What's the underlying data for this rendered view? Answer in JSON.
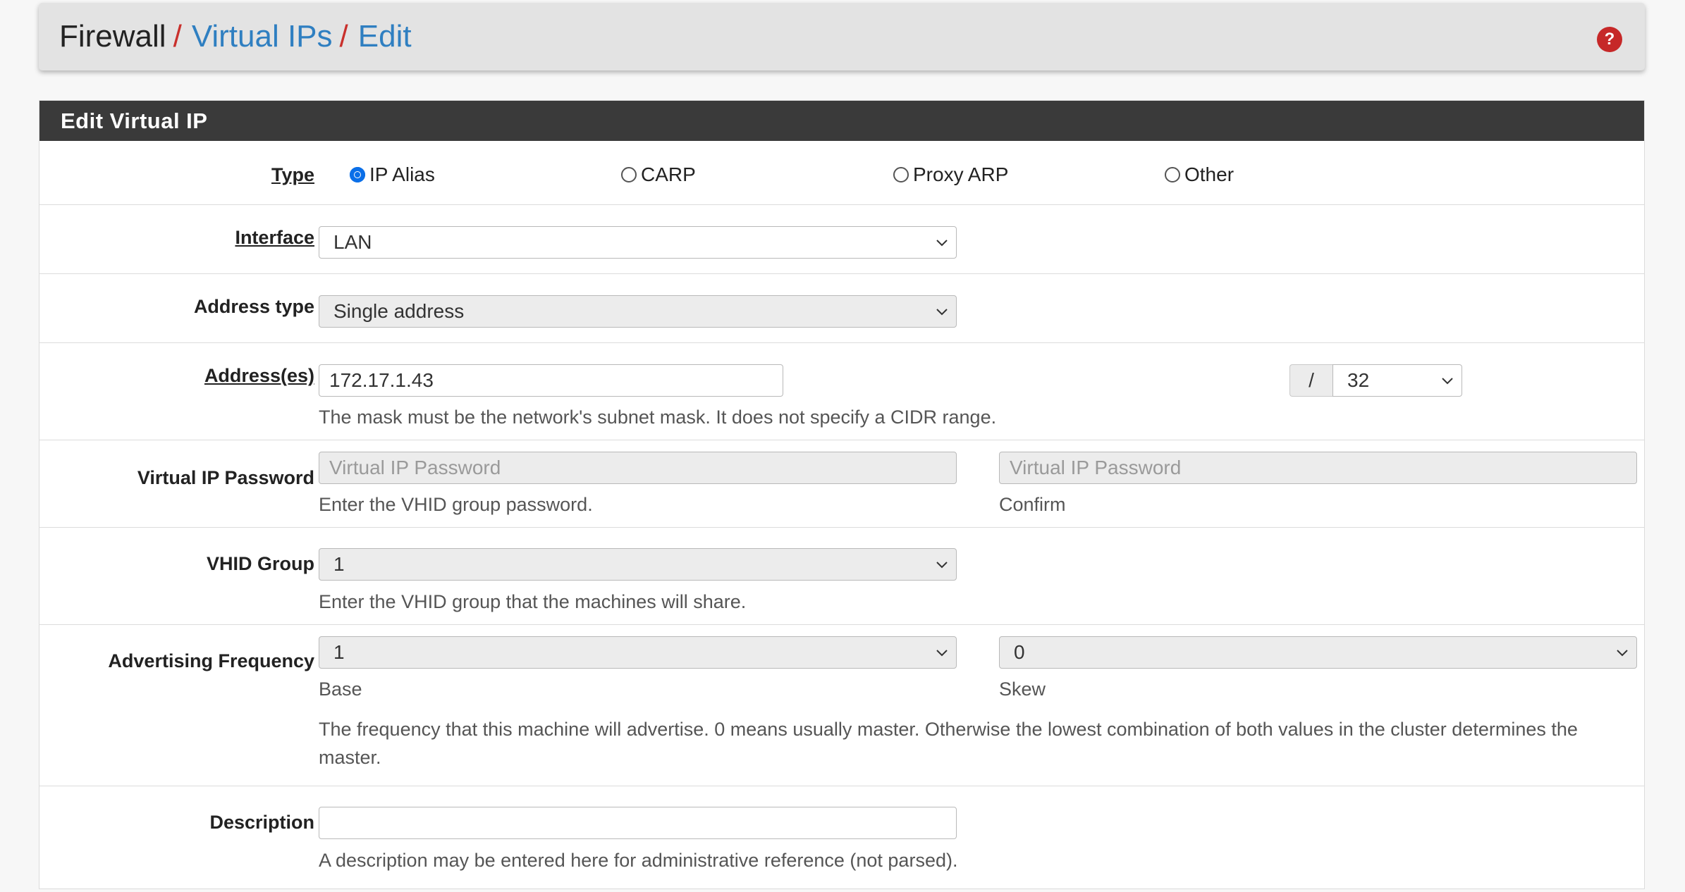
{
  "breadcrumb": {
    "root": "Firewall",
    "separator": "/",
    "items": [
      "Virtual IPs",
      "Edit"
    ]
  },
  "help_icon": "?",
  "panel": {
    "title": "Edit Virtual IP",
    "type": {
      "label": "Type",
      "options": [
        "IP Alias",
        "CARP",
        "Proxy ARP",
        "Other"
      ],
      "selected": "IP Alias"
    },
    "interface": {
      "label": "Interface",
      "value": "LAN"
    },
    "address_type": {
      "label": "Address type",
      "value": "Single address"
    },
    "addresses": {
      "label": "Address(es)",
      "value": "172.17.1.43",
      "mask_separator": "/",
      "mask": "32",
      "help": "The mask must be the network's subnet mask. It does not specify a CIDR range."
    },
    "vip_password": {
      "label": "Virtual IP Password",
      "placeholder": "Virtual IP Password",
      "help": "Enter the VHID group password.",
      "confirm_placeholder": "Virtual IP Password",
      "confirm_help": "Confirm"
    },
    "vhid_group": {
      "label": "VHID Group",
      "value": "1",
      "help": "Enter the VHID group that the machines will share."
    },
    "advertising_frequency": {
      "label": "Advertising Frequency",
      "base_value": "1",
      "base_help": "Base",
      "skew_value": "0",
      "skew_help": "Skew",
      "help": "The frequency that this machine will advertise. 0 means usually master. Otherwise the lowest combination of both values in the cluster determines the master."
    },
    "description": {
      "label": "Description",
      "value": "",
      "help": "A description may be entered here for administrative reference (not parsed)."
    }
  },
  "colors": {
    "link": "#2f7fc1",
    "separator": "#c9302c",
    "panel_heading": "#3a3a3a",
    "radio_checked": "#0b6fe8",
    "help_icon": "#c62828"
  }
}
